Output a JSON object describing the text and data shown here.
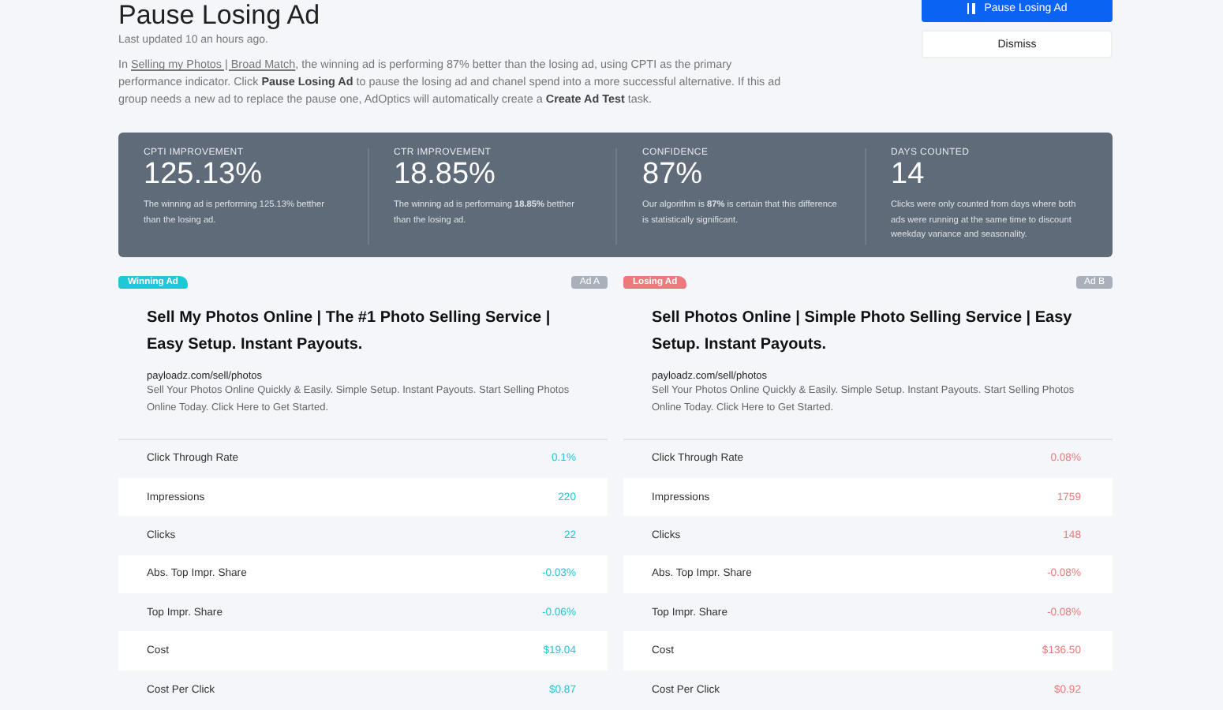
{
  "header": {
    "title": "Pause Losing Ad",
    "updated": "Last updated 10 an hours ago.",
    "description": {
      "before": "In ",
      "link": "Selling my Photos | Broad Match",
      "after": ", the winning ad is performing 87% better than the losing ad, using CPTI as the primary performance indicator. Click **Pause Losing Ad** to pause the losing ad and chanel spend into a more successful alternative. If this ad group needs a new ad to replace the pause one, AdOptics will automatically create a **Create Ad Test** task."
    }
  },
  "actions": [
    {
      "kind": "primary",
      "label": "Pause Losing Ad"
    },
    {
      "kind": "secondary",
      "label": "Dismiss"
    }
  ],
  "stats": [
    {
      "label": "CPTI IMPROVEMENT",
      "value": "125.13%",
      "note": "The winning ad is performing 125.13% betther than the losing ad."
    },
    {
      "label": "CTR IMPROVEMENT",
      "value": "18.85%",
      "note": "The winning ad is performaing **18.85%** betther than the losing ad."
    },
    {
      "label": "CONFIDENCE",
      "value": "87%",
      "note": "Our algorithm is **87%** is certain that this difference is statistically significant."
    },
    {
      "label": "DAYS COUNTED",
      "value": "14",
      "note": "Clicks were only counted from days where both ads were running at the same time to discount weekday variance and seasonality."
    }
  ],
  "ads": [
    {
      "kind": "winning",
      "badge": "Winning Ad",
      "tag": "Ad A",
      "headline": "Sell My Photos Online | The #1 Photo Selling Service | Easy Setup. Instant Payouts.",
      "url": "payloadz.com/sell/photos",
      "text": "Sell Your Photos Online Quickly & Easily. Simple Setup. Instant Payouts. Start Selling Photos Online Today. Click Here to Get Started.",
      "metrics": [
        {
          "label": "Click Through Rate",
          "value": "0.1%"
        },
        {
          "label": "Impressions",
          "value": "220"
        },
        {
          "label": "Clicks",
          "value": "22"
        },
        {
          "label": "Abs. Top Impr. Share",
          "value": "-0.03%"
        },
        {
          "label": "Top Impr. Share",
          "value": "-0.06%"
        },
        {
          "label": "Cost",
          "value": "$19.04"
        },
        {
          "label": "Cost Per Click",
          "value": "$0.87"
        }
      ]
    },
    {
      "kind": "losing",
      "badge": "Losing Ad",
      "tag": "Ad B",
      "headline": "Sell Photos Online | Simple Photo Selling Service | Easy Setup. Instant Payouts.",
      "url": "payloadz.com/sell/photos",
      "text": "Sell Your Photos Online Quickly & Easily. Simple Setup. Instant Payouts. Start Selling Photos Online Today. Click Here to Get Started.",
      "metrics": [
        {
          "label": "Click Through Rate",
          "value": "0.08%"
        },
        {
          "label": "Impressions",
          "value": "1759"
        },
        {
          "label": "Clicks",
          "value": "148"
        },
        {
          "label": "Abs. Top Impr. Share",
          "value": "-0.08%"
        },
        {
          "label": "Top Impr. Share",
          "value": "-0.08%"
        },
        {
          "label": "Cost",
          "value": "$136.50"
        },
        {
          "label": "Cost Per Click",
          "value": "$0.92"
        }
      ]
    }
  ]
}
